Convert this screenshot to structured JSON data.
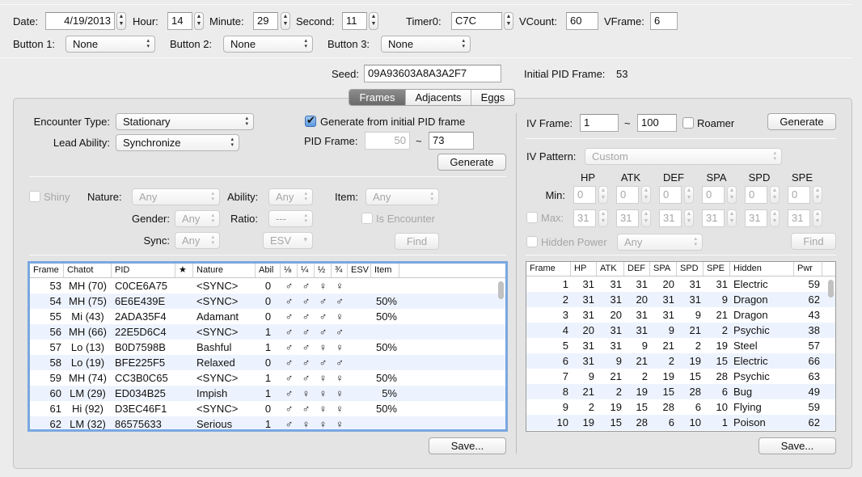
{
  "header": {
    "date_label": "Date:",
    "date": "4/19/2013",
    "hour_label": "Hour:",
    "hour": "14",
    "minute_label": "Minute:",
    "minute": "29",
    "second_label": "Second:",
    "second": "11",
    "timer0_label": "Timer0:",
    "timer0": "C7C",
    "vcount_label": "VCount:",
    "vcount": "60",
    "vframe_label": "VFrame:",
    "vframe": "6",
    "button1_label": "Button 1:",
    "button1": "None",
    "button2_label": "Button 2:",
    "button2": "None",
    "button3_label": "Button 3:",
    "button3": "None",
    "seed_label": "Seed:",
    "seed": "09A93603A8A3A2F7",
    "initial_pid_frame_label": "Initial PID Frame:",
    "initial_pid_frame": "53"
  },
  "tabs": {
    "frames": "Frames",
    "adjacents": "Adjacents",
    "eggs": "Eggs"
  },
  "left": {
    "encounter_type_label": "Encounter Type:",
    "encounter_type": "Stationary",
    "lead_ability_label": "Lead Ability:",
    "lead_ability": "Synchronize",
    "generate_from_initial": "Generate from initial PID frame",
    "pid_frame_label": "PID Frame:",
    "pid_frame_min": "50",
    "pid_frame_tilde": "~",
    "pid_frame_max": "73",
    "generate": "Generate",
    "shiny": "Shiny",
    "nature_label": "Nature:",
    "nature": "Any",
    "ability_label": "Ability:",
    "ability": "Any",
    "item_label": "Item:",
    "item": "Any",
    "gender_label": "Gender:",
    "gender": "Any",
    "ratio_label": "Ratio:",
    "ratio": "---",
    "is_encounter": "Is Encounter",
    "sync_label": "Sync:",
    "sync": "Any",
    "esv": "ESV",
    "find": "Find",
    "save": "Save..."
  },
  "frames_table": {
    "columns": [
      "Frame",
      "Chatot",
      "PID",
      "★",
      "Nature",
      "Abil",
      "⅛",
      "¼",
      "½",
      "¾",
      "ESV",
      "Item"
    ],
    "rows": [
      [
        "53",
        "MH (70)",
        "C0CE6A75",
        "",
        "<SYNC>",
        "0",
        "♂",
        "♂",
        "♀",
        "♀",
        "",
        ""
      ],
      [
        "54",
        "MH (75)",
        "6E6E439E",
        "",
        "<SYNC>",
        "0",
        "♂",
        "♂",
        "♂",
        "♂",
        "",
        "50%"
      ],
      [
        "55",
        "Mi (43)",
        "2ADA35F4",
        "",
        "Adamant",
        "0",
        "♂",
        "♂",
        "♂",
        "♀",
        "",
        "50%"
      ],
      [
        "56",
        "MH (66)",
        "22E5D6C4",
        "",
        "<SYNC>",
        "1",
        "♂",
        "♂",
        "♂",
        "♂",
        "",
        ""
      ],
      [
        "57",
        "Lo (13)",
        "B0D7598B",
        "",
        "Bashful",
        "1",
        "♂",
        "♂",
        "♀",
        "♀",
        "",
        "50%"
      ],
      [
        "58",
        "Lo (19)",
        "BFE225F5",
        "",
        "Relaxed",
        "0",
        "♂",
        "♂",
        "♂",
        "♂",
        "",
        ""
      ],
      [
        "59",
        "MH (74)",
        "CC3B0C65",
        "",
        "<SYNC>",
        "1",
        "♂",
        "♂",
        "♀",
        "♀",
        "",
        "50%"
      ],
      [
        "60",
        "LM (29)",
        "ED034B25",
        "",
        "Impish",
        "1",
        "♂",
        "♀",
        "♀",
        "♀",
        "",
        "5%"
      ],
      [
        "61",
        "Hi (92)",
        "D3EC46F1",
        "",
        "<SYNC>",
        "0",
        "♂",
        "♂",
        "♀",
        "♀",
        "",
        "50%"
      ],
      [
        "62",
        "LM (32)",
        "86575633",
        "",
        "Serious",
        "1",
        "♂",
        "♀",
        "♀",
        "♀",
        "",
        ""
      ]
    ]
  },
  "right": {
    "iv_frame_label": "IV Frame:",
    "iv_frame_min": "1",
    "iv_frame_tilde": "~",
    "iv_frame_max": "100",
    "roamer": "Roamer",
    "generate": "Generate",
    "iv_pattern_label": "IV Pattern:",
    "iv_pattern": "Custom",
    "stat_headers": [
      "HP",
      "ATK",
      "DEF",
      "SPA",
      "SPD",
      "SPE"
    ],
    "min_label": "Min:",
    "min_values": [
      "0",
      "0",
      "0",
      "0",
      "0",
      "0"
    ],
    "max_label": "Max:",
    "max_values": [
      "31",
      "31",
      "31",
      "31",
      "31",
      "31"
    ],
    "hidden_power_label": "Hidden Power",
    "hidden_power": "Any",
    "find": "Find",
    "save": "Save..."
  },
  "iv_table": {
    "columns": [
      "Frame",
      "HP",
      "ATK",
      "DEF",
      "SPA",
      "SPD",
      "SPE",
      "Hidden",
      "Pwr"
    ],
    "rows": [
      [
        "1",
        "31",
        "31",
        "31",
        "20",
        "31",
        "31",
        "Electric",
        "59"
      ],
      [
        "2",
        "31",
        "31",
        "20",
        "31",
        "31",
        "9",
        "Dragon",
        "62"
      ],
      [
        "3",
        "31",
        "20",
        "31",
        "31",
        "9",
        "21",
        "Dragon",
        "43"
      ],
      [
        "4",
        "20",
        "31",
        "31",
        "9",
        "21",
        "2",
        "Psychic",
        "38"
      ],
      [
        "5",
        "31",
        "31",
        "9",
        "21",
        "2",
        "19",
        "Steel",
        "57"
      ],
      [
        "6",
        "31",
        "9",
        "21",
        "2",
        "19",
        "15",
        "Electric",
        "66"
      ],
      [
        "7",
        "9",
        "21",
        "2",
        "19",
        "15",
        "28",
        "Psychic",
        "63"
      ],
      [
        "8",
        "21",
        "2",
        "19",
        "15",
        "28",
        "6",
        "Bug",
        "49"
      ],
      [
        "9",
        "2",
        "19",
        "15",
        "28",
        "6",
        "10",
        "Flying",
        "59"
      ],
      [
        "10",
        "19",
        "15",
        "28",
        "6",
        "10",
        "1",
        "Poison",
        "62"
      ]
    ]
  }
}
